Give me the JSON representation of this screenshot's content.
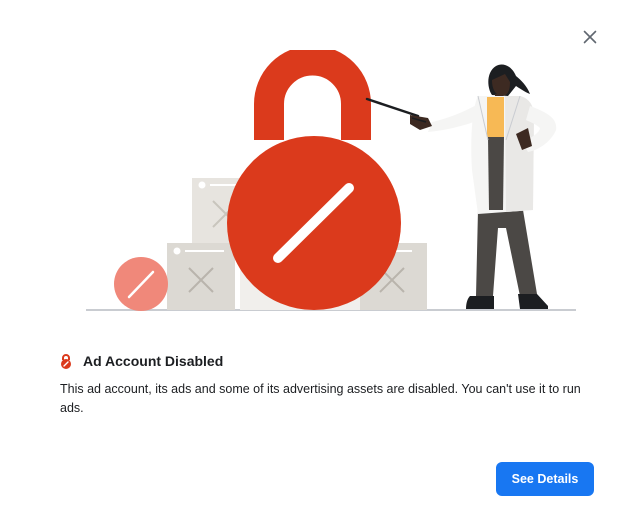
{
  "dialog": {
    "close_icon": "close-icon",
    "illustration": "ad-account-disabled-illustration",
    "title_icon": "lock-disabled-icon",
    "title": "Ad Account Disabled",
    "description": "This ad account, its ads and some of its advertising assets are disabled. You can't use it to run ads.",
    "primary_button": "See Details"
  },
  "colors": {
    "accent_blue": "#1877f2",
    "lock_red": "#db3a1c",
    "small_lock_salmon": "#f0887a",
    "box_gray": "#dcd9d3",
    "text": "#1c1e21"
  }
}
